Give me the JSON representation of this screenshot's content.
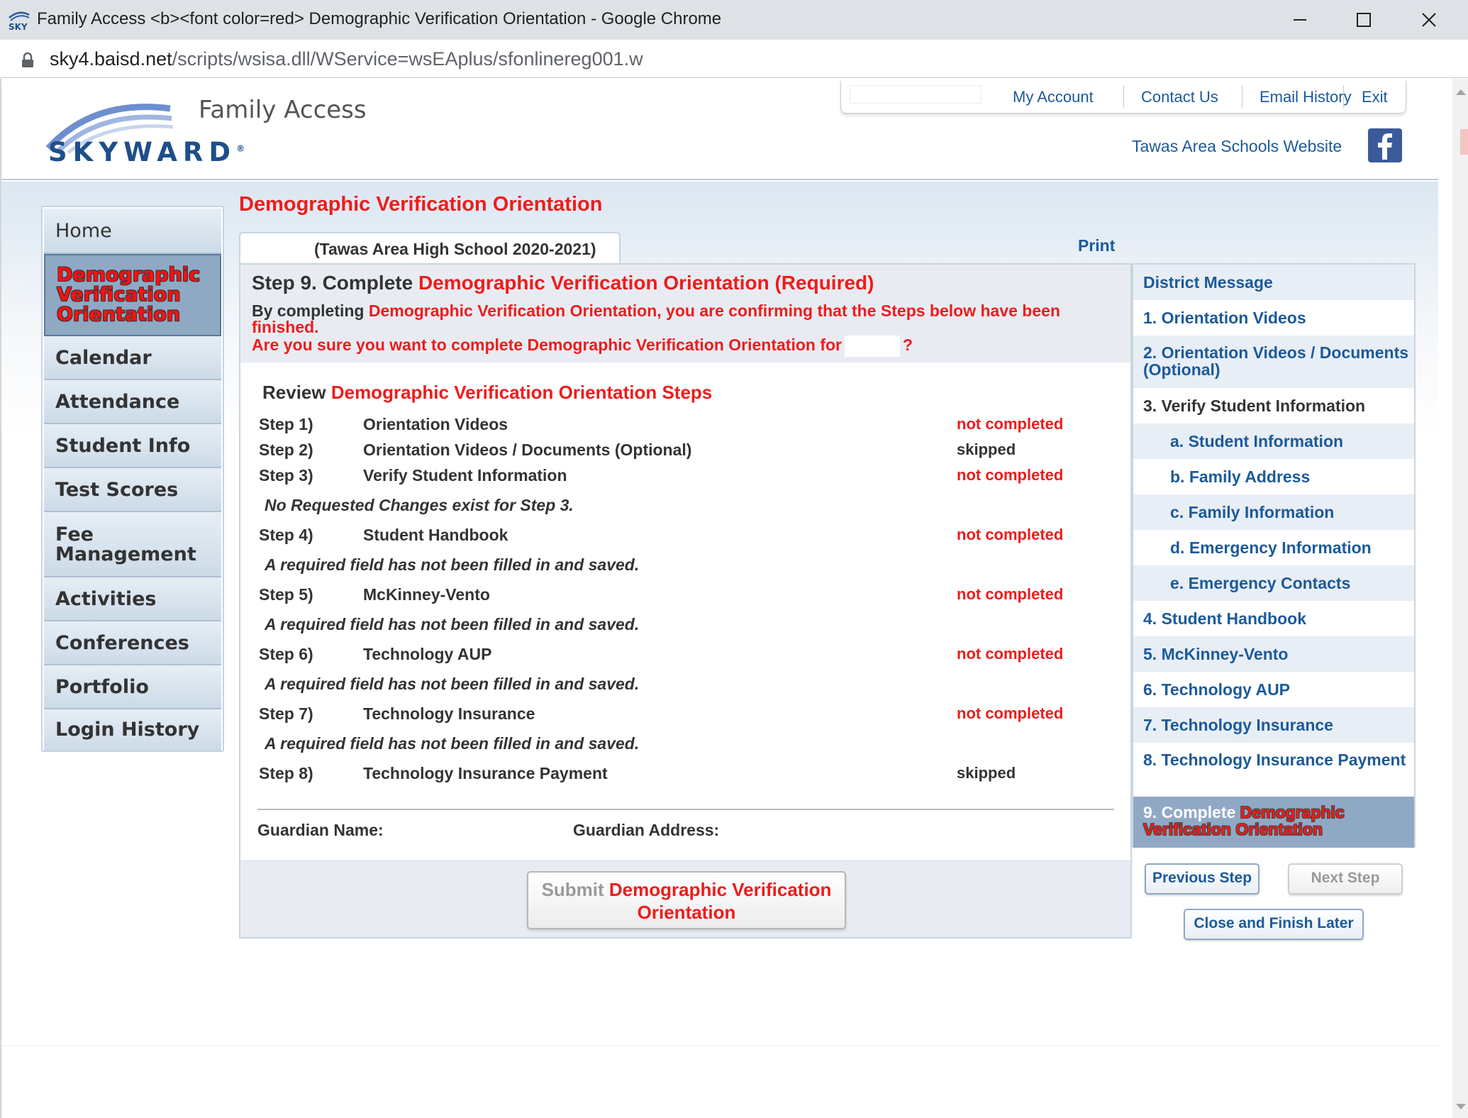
{
  "browser": {
    "window_title": "Family Access <b><font color=red> Demographic Verification Orientation - Google Chrome",
    "url_host": "sky4.baisd.net",
    "url_path": "/scripts/wsisa.dll/WService=wsEAplus/sfonlinereg001.w"
  },
  "header": {
    "logo_text": "SKYWARD",
    "logo_reg": "®",
    "app_title": "Family Access",
    "links": [
      "My Account",
      "Contact Us",
      "Email History",
      "Exit"
    ],
    "school_website": "Tawas Area Schools Website"
  },
  "leftnav": {
    "items": [
      "Home",
      "Demographic Verification Orientation",
      "Calendar",
      "Attendance",
      "Student Info",
      "Test Scores",
      "Fee Management",
      "Activities",
      "Conferences",
      "Portfolio",
      "Login History"
    ]
  },
  "main": {
    "heading": "Demographic Verification Orientation",
    "school_tab": "(Tawas Area High School 2020-2021)",
    "print": "Print",
    "step_title_prefix": "Step 9. Complete ",
    "step_title_red": "Demographic Verification Orientation (Required)",
    "confirm_prefix": "By completing ",
    "confirm_red": "Demographic Verification Orientation, you are confirming that the Steps below have been finished.",
    "question": "Are you sure you want to complete Demographic Verification Orientation for",
    "question_end": "?",
    "review_prefix": "Review ",
    "review_red": "Demographic Verification Orientation Steps",
    "steps": [
      {
        "num": "Step 1)",
        "name": "Orientation Videos",
        "status": "not completed"
      },
      {
        "num": "Step 2)",
        "name": "Orientation Videos / Documents (Optional)",
        "status": "skipped"
      },
      {
        "num": "Step 3)",
        "name": "Verify Student Information",
        "status": "not completed"
      },
      {
        "num": "Step 4)",
        "name": "Student Handbook",
        "status": "not completed"
      },
      {
        "num": "Step 5)",
        "name": "McKinney-Vento",
        "status": "not completed"
      },
      {
        "num": "Step 6)",
        "name": "Technology AUP",
        "status": "not completed"
      },
      {
        "num": "Step 7)",
        "name": "Technology Insurance",
        "status": "not completed"
      },
      {
        "num": "Step 8)",
        "name": "Technology Insurance Payment",
        "status": "skipped"
      }
    ],
    "notes": {
      "step3": "No Requested Changes exist for Step 3.",
      "required": "A required field has not been filled in and saved."
    },
    "guardian_name_label": "Guardian Name:",
    "guardian_address_label": "Guardian Address:",
    "submit_gray": "Submit",
    "submit_red": "Demographic Verification Orientation"
  },
  "rightnav": {
    "items": [
      "District Message",
      "1. Orientation Videos",
      "2. Orientation Videos / Documents (Optional)",
      "3. Verify Student Information",
      "a. Student Information",
      "b. Family Address",
      "c. Family Information",
      "d. Emergency Information",
      "e. Emergency Contacts",
      "4. Student Handbook",
      "5. McKinney-Vento",
      "6. Technology AUP",
      "7. Technology Insurance",
      "8. Technology Insurance Payment"
    ],
    "active_prefix": "9. Complete ",
    "active_red": "Demographic Verification Orientation",
    "previous_step": "Previous Step",
    "next_step": "Next Step",
    "close_finish": "Close and Finish Later"
  },
  "colors": {
    "accent_red": "#ee1c1c",
    "link_blue": "#1c5a9a",
    "nav_active": "#8fa9c5",
    "panel_bg": "#e8ecf2"
  }
}
